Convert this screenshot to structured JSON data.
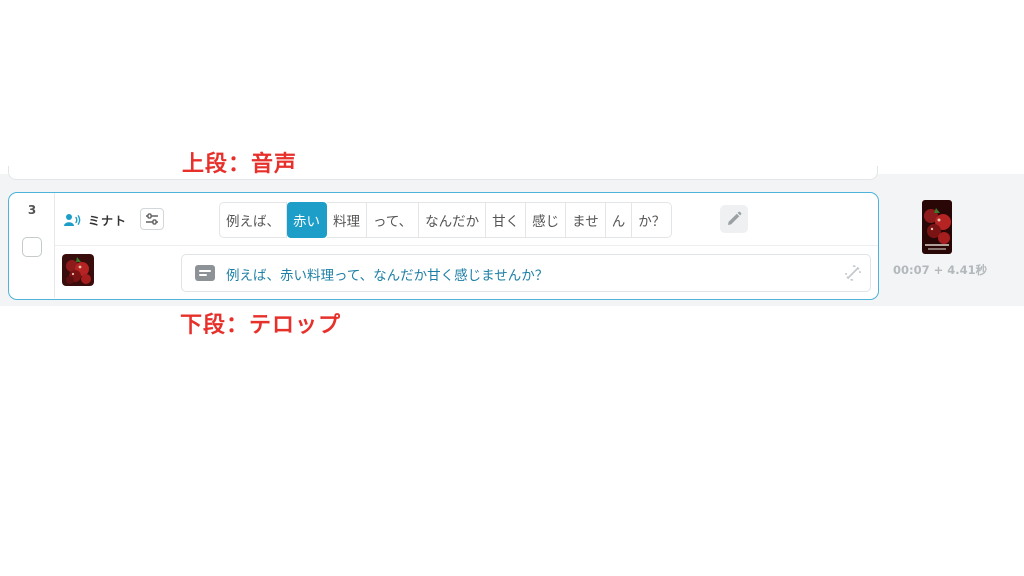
{
  "annotations": {
    "top_label": "上段：音声",
    "bottom_label": "下段：テロップ"
  },
  "row": {
    "number": "3",
    "speaker": {
      "name": "ミナト",
      "icon": "speaker-voice-icon"
    },
    "words": [
      {
        "text": "例えば、",
        "selected": false
      },
      {
        "text": "赤い",
        "selected": true
      },
      {
        "text": "料理",
        "selected": false
      },
      {
        "text": "って、",
        "selected": false
      },
      {
        "text": "なんだか",
        "selected": false
      },
      {
        "text": "甘く",
        "selected": false
      },
      {
        "text": "感じ",
        "selected": false
      },
      {
        "text": "ませ",
        "selected": false
      },
      {
        "text": "ん",
        "selected": false
      },
      {
        "text": "か？",
        "selected": false
      }
    ],
    "caption": "例えば、赤い料理って、なんだか甘く感じませんか？",
    "time": "00:07 + 4.41秒"
  },
  "colors": {
    "accent": "#1d9ec9",
    "card_border": "#4fb3d9",
    "annotation_red": "#e8302b",
    "caption_text": "#1e7fa6"
  }
}
